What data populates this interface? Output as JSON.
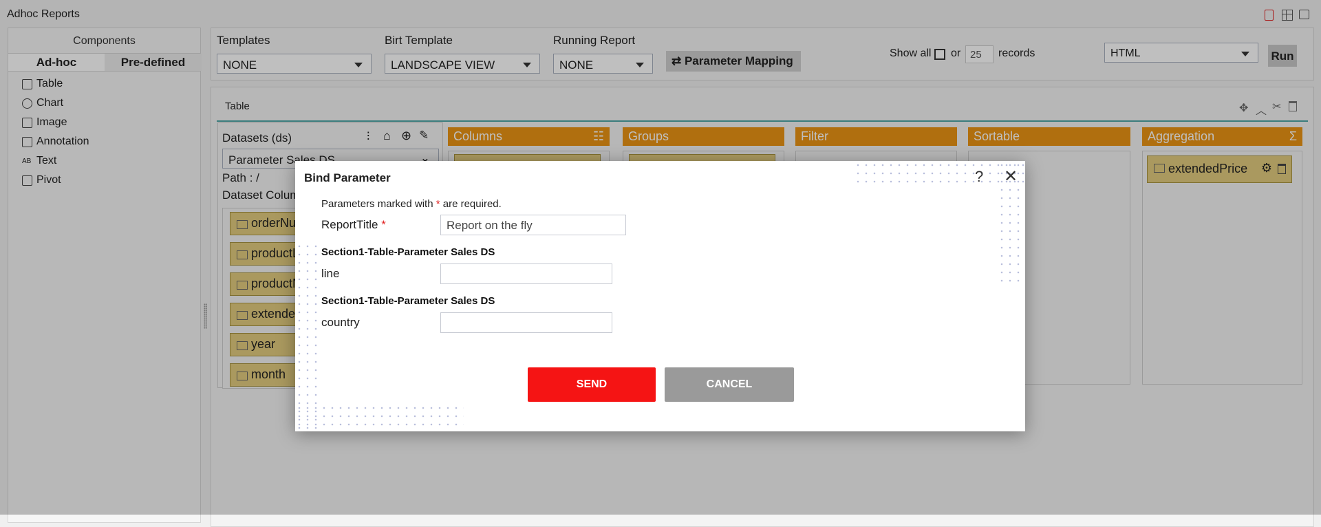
{
  "app": {
    "title": "Adhoc Reports",
    "header_icons": [
      "save-icon",
      "grid-icon",
      "comment-icon"
    ]
  },
  "components": {
    "title": "Components",
    "tabs": [
      "Ad-hoc",
      "Pre-defined"
    ],
    "items": [
      {
        "label": "Table",
        "icon": "table-icon"
      },
      {
        "label": "Chart",
        "icon": "chart-icon"
      },
      {
        "label": "Image",
        "icon": "image-icon"
      },
      {
        "label": "Annotation",
        "icon": "annotation-icon"
      },
      {
        "label": "Text",
        "icon": "text-icon"
      },
      {
        "label": "Pivot",
        "icon": "pivot-icon"
      }
    ]
  },
  "toolbar": {
    "templates_label": "Templates",
    "templates_value": "NONE",
    "birt_label": "Birt Template",
    "birt_value": "LANDSCAPE VIEW",
    "running_label": "Running Report",
    "running_value": "NONE",
    "param_mapping": "Parameter Mapping",
    "show_all": "Show all",
    "or": "or",
    "records_value": "25",
    "records": "records",
    "format_value": "HTML",
    "run": "Run"
  },
  "table_panel": {
    "title": "Table",
    "datasets_label": "Datasets (ds)",
    "dataset_value": "Parameter Sales DS",
    "path": "Path :  /",
    "dataset_columns": "Dataset Columns",
    "columns": [
      "orderNumber",
      "productLine",
      "productName",
      "extendedPrice",
      "year",
      "month"
    ],
    "sections": [
      "Columns",
      "Groups",
      "Filter",
      "Sortable",
      "Aggregation"
    ],
    "aggregation_item": "extendedPrice"
  },
  "modal": {
    "title": "Bind Parameter",
    "note_before": "Parameters marked with ",
    "note_star": "*",
    "note_after": " are required.",
    "report_title_label": "ReportTitle",
    "report_title_value": "Report on the fly",
    "section1": "Section1-Table-Parameter Sales DS",
    "line_label": "line",
    "line_value": "",
    "section2": "Section1-Table-Parameter Sales DS",
    "country_label": "country",
    "country_value": "",
    "send": "SEND",
    "cancel": "CANCEL",
    "send_color": "#f51414",
    "cancel_color": "#9a9a9a"
  }
}
